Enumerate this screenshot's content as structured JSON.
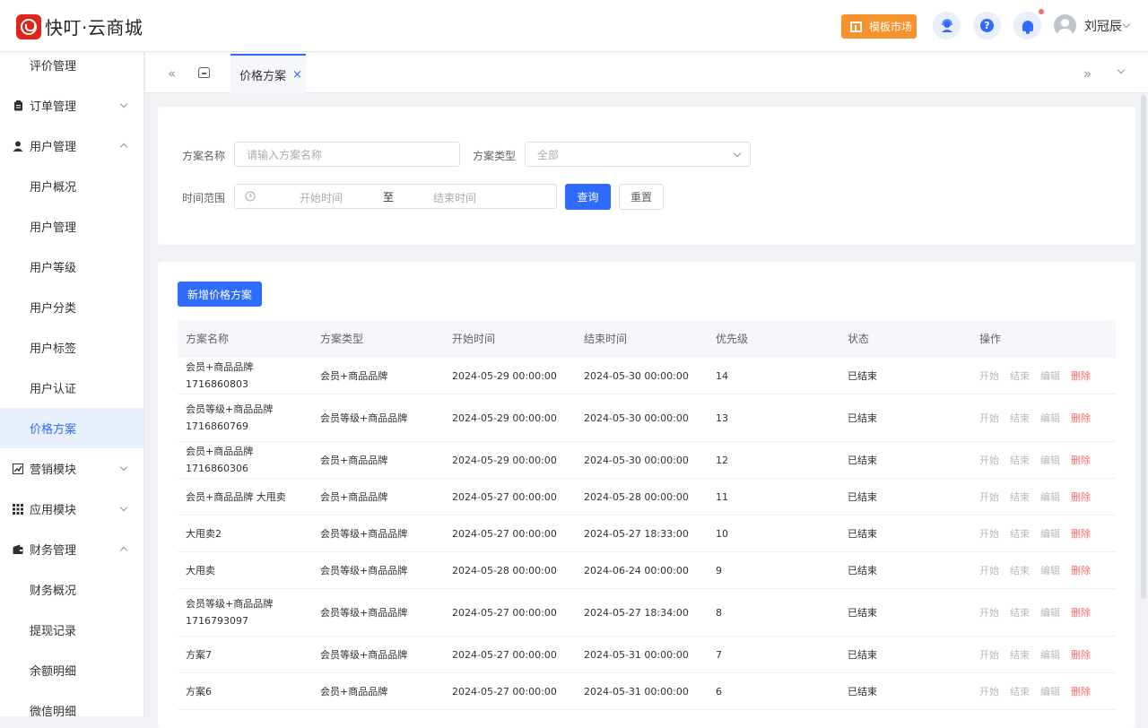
{
  "header": {
    "logo_text": "快叮·云商城",
    "template_market": "模板市场",
    "help_glyph": "?",
    "username": "刘冠辰"
  },
  "sidebar": {
    "items": [
      {
        "type": "sub",
        "label": "评价管理"
      },
      {
        "type": "group",
        "label": "订单管理",
        "icon": "clipboard-icon",
        "expanded": false
      },
      {
        "type": "group",
        "label": "用户管理",
        "icon": "user-icon",
        "expanded": true
      },
      {
        "type": "sub",
        "label": "用户概况"
      },
      {
        "type": "sub",
        "label": "用户管理"
      },
      {
        "type": "sub",
        "label": "用户等级"
      },
      {
        "type": "sub",
        "label": "用户分类"
      },
      {
        "type": "sub",
        "label": "用户标签"
      },
      {
        "type": "sub",
        "label": "用户认证"
      },
      {
        "type": "sub",
        "label": "价格方案",
        "active": true
      },
      {
        "type": "group",
        "label": "营销模块",
        "icon": "chart-icon",
        "expanded": false
      },
      {
        "type": "group",
        "label": "应用模块",
        "icon": "grid-icon",
        "expanded": false
      },
      {
        "type": "group",
        "label": "财务管理",
        "icon": "wallet-icon",
        "expanded": true
      },
      {
        "type": "sub",
        "label": "财务概况"
      },
      {
        "type": "sub",
        "label": "提现记录"
      },
      {
        "type": "sub",
        "label": "余额明细"
      },
      {
        "type": "sub",
        "label": "微信明细"
      }
    ]
  },
  "tabs": {
    "active_label": "价格方案",
    "close_glyph": "×"
  },
  "filters": {
    "name_label": "方案名称",
    "name_placeholder": "请输入方案名称",
    "type_label": "方案类型",
    "type_value": "全部",
    "time_label": "时间范围",
    "start_placeholder": "开始时间",
    "range_sep": "至",
    "end_placeholder": "结束时间",
    "query_btn": "查询",
    "reset_btn": "重置"
  },
  "toolbar": {
    "add_btn": "新增价格方案"
  },
  "table": {
    "columns": [
      "方案名称",
      "方案类型",
      "开始时间",
      "结束时间",
      "优先级",
      "状态",
      "操作"
    ],
    "actions": [
      "开始",
      "结束",
      "编辑",
      "删除"
    ],
    "rows": [
      {
        "name": "会员+商品品牌1716860803",
        "type": "会员+商品品牌",
        "start": "2024-05-29 00:00:00",
        "end": "2024-05-30 00:00:00",
        "priority": "14",
        "status": "已结束"
      },
      {
        "name": "会员等级+商品品牌1716860769",
        "type": "会员等级+商品品牌",
        "start": "2024-05-29 00:00:00",
        "end": "2024-05-30 00:00:00",
        "priority": "13",
        "status": "已结束"
      },
      {
        "name": "会员+商品品牌1716860306",
        "type": "会员+商品品牌",
        "start": "2024-05-29 00:00:00",
        "end": "2024-05-30 00:00:00",
        "priority": "12",
        "status": "已结束"
      },
      {
        "name": "会员+商品品牌 大甩卖",
        "type": "会员+商品品牌",
        "start": "2024-05-27 00:00:00",
        "end": "2024-05-28 00:00:00",
        "priority": "11",
        "status": "已结束"
      },
      {
        "name": "大甩卖2",
        "type": "会员等级+商品品牌",
        "start": "2024-05-27 00:00:00",
        "end": "2024-05-27 18:33:00",
        "priority": "10",
        "status": "已结束"
      },
      {
        "name": "大甩卖",
        "type": "会员等级+商品品牌",
        "start": "2024-05-28 00:00:00",
        "end": "2024-06-24 00:00:00",
        "priority": "9",
        "status": "已结束"
      },
      {
        "name": "会员等级+商品品牌1716793097",
        "type": "会员等级+商品品牌",
        "start": "2024-05-27 00:00:00",
        "end": "2024-05-27 18:34:00",
        "priority": "8",
        "status": "已结束"
      },
      {
        "name": "方案7",
        "type": "会员等级+商品品牌",
        "start": "2024-05-27 00:00:00",
        "end": "2024-05-31 00:00:00",
        "priority": "7",
        "status": "已结束"
      },
      {
        "name": "方案6",
        "type": "会员+商品品牌",
        "start": "2024-05-27 00:00:00",
        "end": "2024-05-31 00:00:00",
        "priority": "6",
        "status": "已结束"
      }
    ]
  },
  "colors": {
    "primary": "#2f6bff",
    "danger": "#f56c6c",
    "brand": "#e0251b",
    "template_btn": "#f7932d"
  }
}
